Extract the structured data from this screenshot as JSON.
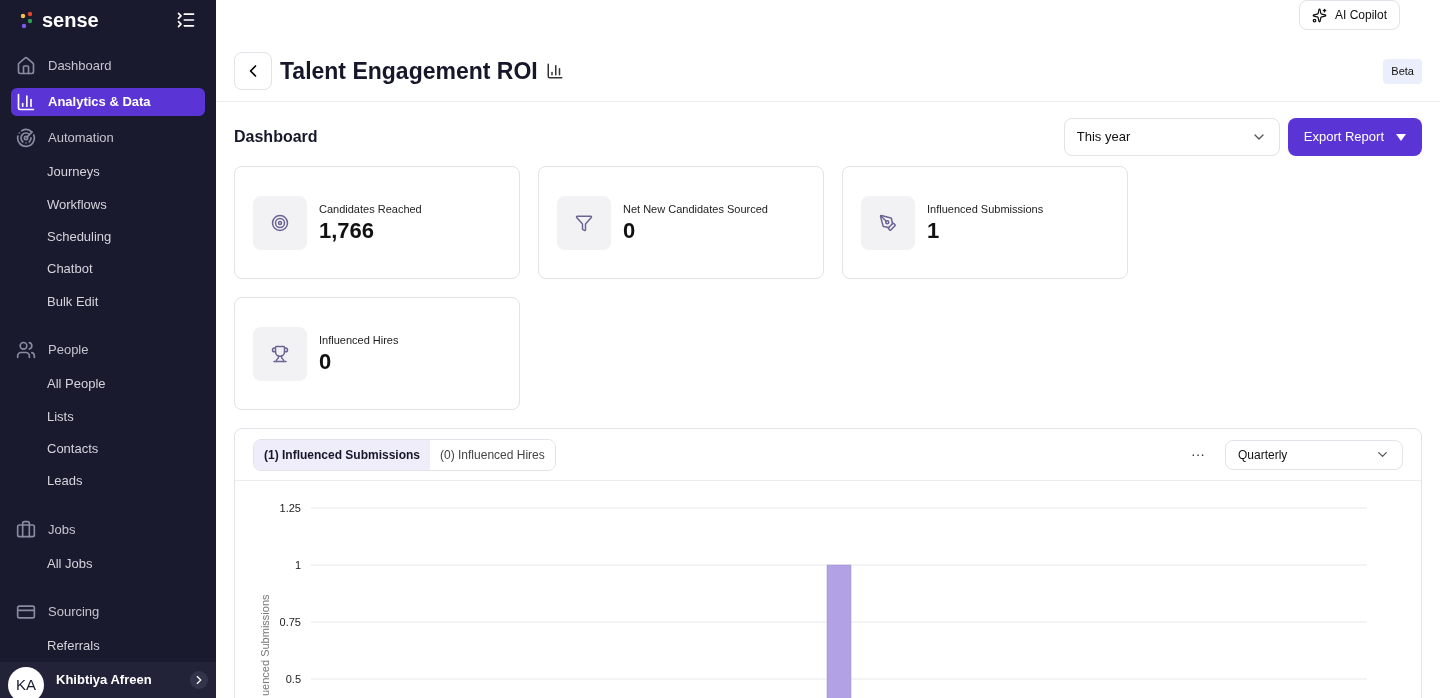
{
  "sidebar": {
    "brand": "sense",
    "sections": [
      {
        "kind": "single",
        "label": "Dashboard",
        "selected": false
      },
      {
        "kind": "single",
        "label": "Analytics & Data",
        "selected": true
      },
      {
        "kind": "group",
        "label": "Automation",
        "selected": false,
        "children": [
          {
            "label": "Journeys"
          },
          {
            "label": "Workflows"
          },
          {
            "label": "Scheduling"
          },
          {
            "label": "Chatbot"
          },
          {
            "label": "Bulk Edit"
          }
        ]
      },
      {
        "kind": "group",
        "label": "People",
        "selected": false,
        "children": [
          {
            "label": "All People"
          },
          {
            "label": "Lists"
          },
          {
            "label": "Contacts"
          },
          {
            "label": "Leads"
          }
        ]
      },
      {
        "kind": "group",
        "label": "Jobs",
        "selected": false,
        "children": [
          {
            "label": "All Jobs"
          }
        ]
      },
      {
        "kind": "group",
        "label": "Sourcing",
        "selected": false,
        "children": [
          {
            "label": "Referrals"
          }
        ]
      }
    ],
    "user": {
      "initials": "KA",
      "name": "Khibtiya Afreen"
    }
  },
  "header": {
    "copilot": "AI Copilot",
    "title": "Talent Engagement ROI",
    "badge": "Beta"
  },
  "dashboard": {
    "title": "Dashboard",
    "period": "This year",
    "export": "Export Report",
    "metrics": [
      {
        "label": "Candidates Reached",
        "value": "1,766"
      },
      {
        "label": "Net New Candidates Sourced",
        "value": "0"
      },
      {
        "label": "Influenced Submissions",
        "value": "1"
      },
      {
        "label": "Influenced Hires",
        "value": "0"
      }
    ]
  },
  "chart_panel": {
    "tabs": [
      {
        "label": "(1) Influenced Submissions",
        "selected": true
      },
      {
        "label": "(0) Influenced Hires",
        "selected": false
      }
    ],
    "more": "···",
    "interval": "Quarterly",
    "chart_data": {
      "type": "bar",
      "ylabel": "uenced Submissions",
      "ylim": [
        0,
        1.25
      ],
      "grid": true,
      "yticks": [
        0.5,
        0.75,
        1,
        1.25
      ],
      "series": [
        {
          "color": "#b3a1e6",
          "values": [
            null,
            null,
            null,
            null,
            1,
            null,
            null,
            null,
            null
          ]
        }
      ]
    }
  }
}
